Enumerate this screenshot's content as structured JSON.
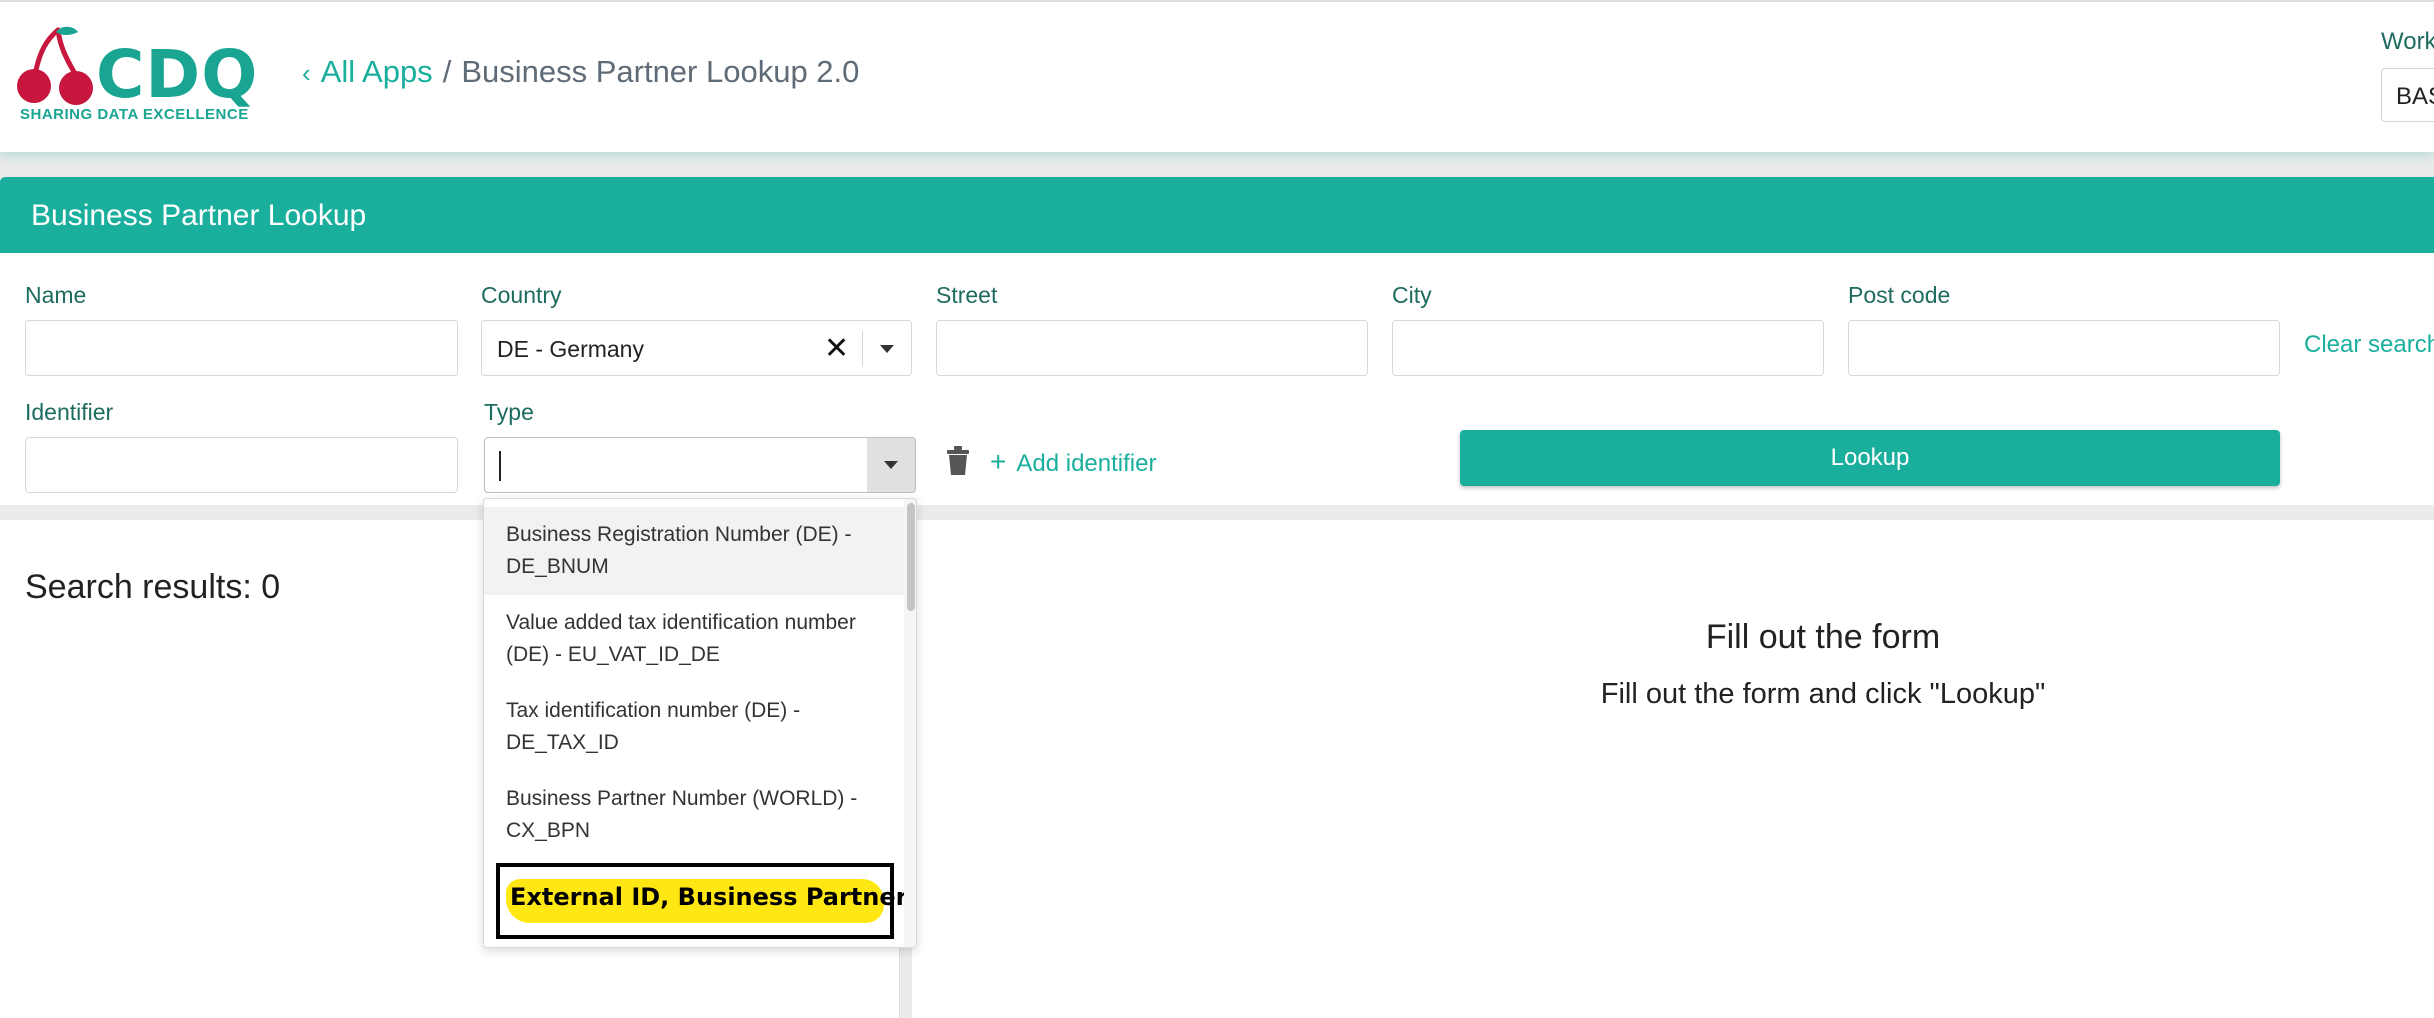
{
  "header": {
    "logo_text": "CDQ",
    "logo_tagline": "SHARING DATA EXCELLENCE",
    "breadcrumb_back": "All Apps",
    "breadcrumb_separator": "/",
    "breadcrumb_current": "Business Partner Lookup 2.0",
    "workspace_label": "Work",
    "workspace_value": "BAS"
  },
  "panel": {
    "title": "Business Partner Lookup"
  },
  "form": {
    "name_label": "Name",
    "name_value": "",
    "country_label": "Country",
    "country_value": "DE - Germany",
    "street_label": "Street",
    "street_value": "",
    "city_label": "City",
    "city_value": "",
    "postcode_label": "Post code",
    "postcode_value": "",
    "clear_search": "Clear search",
    "identifier_label": "Identifier",
    "identifier_value": "",
    "type_label": "Type",
    "type_value": "",
    "add_identifier": "Add identifier",
    "lookup_button": "Lookup"
  },
  "type_dropdown": {
    "options": [
      {
        "line1": "Business Registration Number (DE) -",
        "line2": "DE_BNUM"
      },
      {
        "line1": "Value added tax identification number",
        "line2": "(DE) - EU_VAT_ID_DE"
      },
      {
        "line1": "Tax identification number (DE) -",
        "line2": "DE_TAX_ID"
      },
      {
        "line1": "Business Partner Number (WORLD) -",
        "line2": "CX_BPN"
      }
    ],
    "highlighted_option": "External ID, Business Partner ID"
  },
  "results": {
    "count_label": "Search results: 0",
    "empty_title": "Fill out the form",
    "empty_subtitle": "Fill out the form and click \"Lookup\""
  },
  "colors": {
    "brand_teal": "#1aaf9d",
    "logo_red": "#c8173f",
    "highlight_yellow": "#ffe714"
  }
}
